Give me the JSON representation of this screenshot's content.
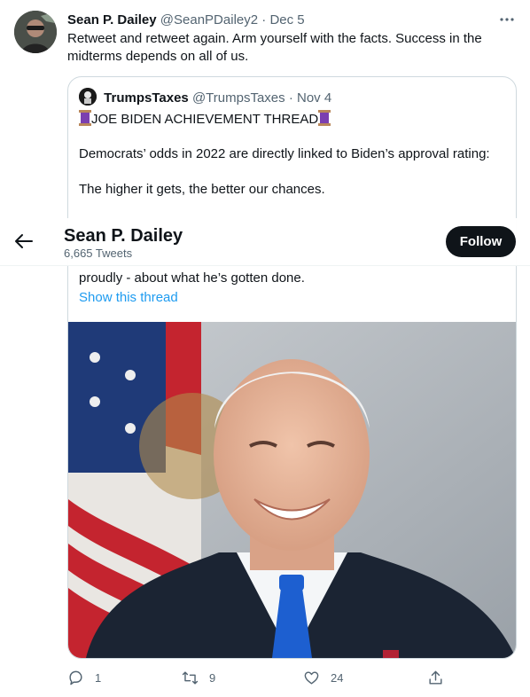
{
  "tweet": {
    "author_name": "Sean P. Dailey",
    "author_handle": "@SeanPDailey2",
    "separator": "·",
    "date": "Dec 5",
    "more_label": "···",
    "text": "Retweet and retweet again. Arm yourself with the facts. Success in the midterms depends on all of us."
  },
  "quote": {
    "author_name": "TrumpsTaxes",
    "author_handle": "@TrumpsTaxes",
    "separator": "·",
    "date": "Nov 4",
    "line1": "JOE BIDEN ACHIEVEMENT THREAD",
    "line2": "Democrats’ odds in 2022 are directly linked to Biden’s approval rating:",
    "line3": "The higher it gets, the better our chances.",
    "line4": "proudly - about what he’s gotten done.",
    "show_thread": "Show this thread"
  },
  "profile_bar": {
    "name": "Sean P. Dailey",
    "tweet_count": "6,665 Tweets",
    "follow_label": "Follow"
  },
  "actions": {
    "replies": "1",
    "retweets": "9",
    "likes": "24"
  },
  "colors": {
    "accent": "#1d9bf0",
    "secondary_text": "#536471",
    "follow_bg": "#0f1419"
  }
}
